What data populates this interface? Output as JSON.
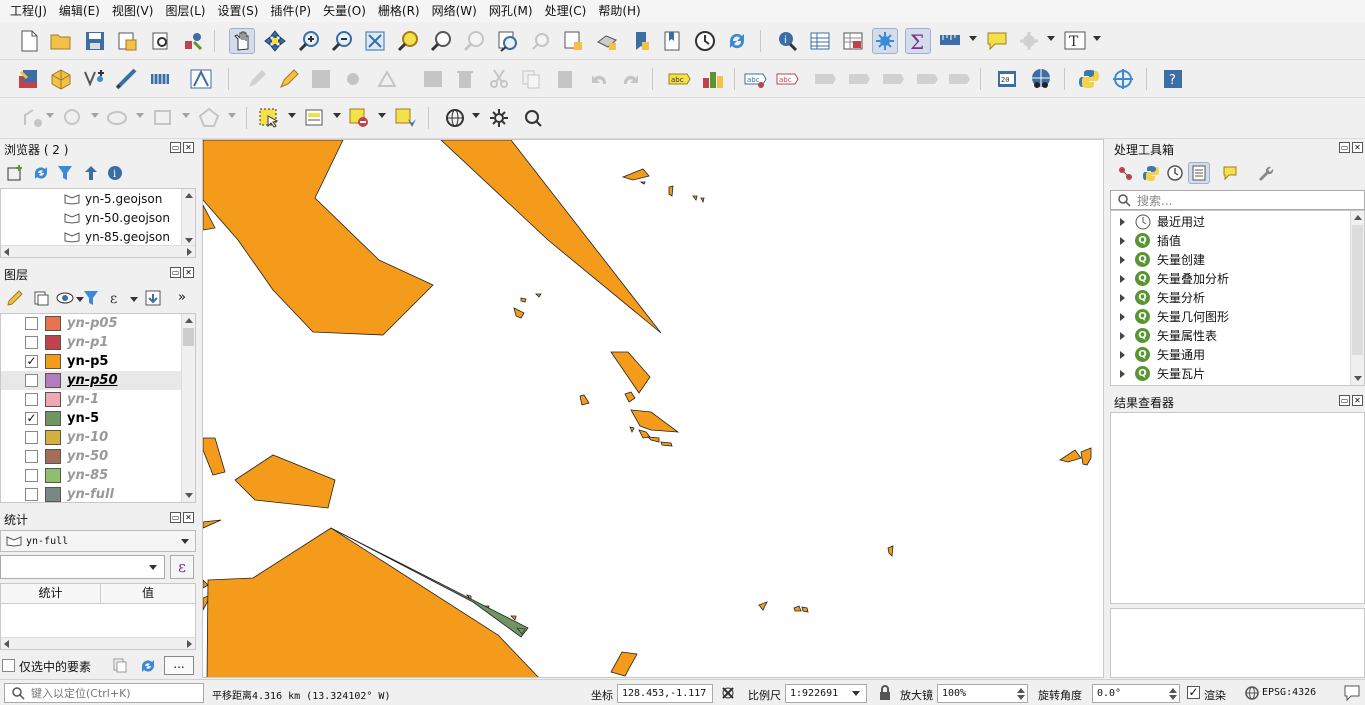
{
  "menus": [
    "工程(J)",
    "编辑(E)",
    "视图(V)",
    "图层(L)",
    "设置(S)",
    "插件(P)",
    "矢量(O)",
    "栅格(R)",
    "网络(W)",
    "网孔(M)",
    "处理(C)",
    "帮助(H)"
  ],
  "browser": {
    "title": "浏览器 ( 2 )",
    "items": [
      "yn-5.geojson",
      "yn-50.geojson",
      "yn-85.geojson"
    ]
  },
  "layers": {
    "title": "图层",
    "items": [
      {
        "name": "yn-p05",
        "color": "#e8734f",
        "checked": false,
        "visible": false
      },
      {
        "name": "yn-p1",
        "color": "#c0434b",
        "checked": false,
        "visible": false
      },
      {
        "name": "yn-p5",
        "color": "#f59b1c",
        "checked": true,
        "visible": true
      },
      {
        "name": "yn-p50",
        "color": "#b47cbe",
        "checked": false,
        "visible": false
      },
      {
        "name": "yn-1",
        "color": "#f0a7b4",
        "checked": false,
        "visible": false
      },
      {
        "name": "yn-5",
        "color": "#6f9563",
        "checked": true,
        "visible": true
      },
      {
        "name": "yn-10",
        "color": "#d4b13c",
        "checked": false,
        "visible": false
      },
      {
        "name": "yn-50",
        "color": "#a36d58",
        "checked": false,
        "visible": false
      },
      {
        "name": "yn-85",
        "color": "#8dbf6e",
        "checked": false,
        "visible": false
      },
      {
        "name": "yn-full",
        "color": "#7a8784",
        "checked": false,
        "visible": false
      }
    ]
  },
  "stats": {
    "title": "统计",
    "layer_select": "yn-full",
    "col_stat": "统计",
    "col_value": "值",
    "only_selected": "仅选中的要素",
    "more": "..."
  },
  "toolbox": {
    "title": "处理工具箱",
    "search_placeholder": "搜索...",
    "items": [
      "最近用过",
      "插值",
      "矢量创建",
      "矢量叠加分析",
      "矢量分析",
      "矢量几何图形",
      "矢量属性表",
      "矢量通用",
      "矢量瓦片"
    ]
  },
  "results": {
    "title": "结果查看器"
  },
  "status": {
    "locate_placeholder": "键入以定位(Ctrl+K)",
    "measure": "平移距离4.316 km (13.324102° W)",
    "coord_label": "坐标",
    "coord": "128.453,-1.117",
    "scale_label": "比例尺",
    "scale": "1:922691",
    "magnifier_label": "放大镜",
    "magnifier": "100%",
    "rotation_label": "旋转角度",
    "rotation": "0.0°",
    "render_label": "渲染",
    "crs": "EPSG:4326"
  },
  "colors": {
    "orange": "#f59b1c",
    "green": "#6f9563"
  }
}
